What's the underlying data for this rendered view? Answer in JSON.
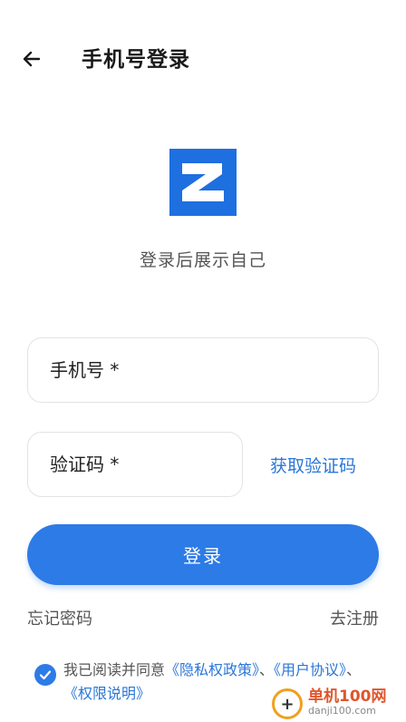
{
  "header": {
    "title": "手机号登录"
  },
  "logo": {
    "letter": "Z",
    "color": "#1e6fe0"
  },
  "tagline": "登录后展示自己",
  "form": {
    "phone_placeholder": "手机号 *",
    "code_placeholder": "验证码 *",
    "get_code_label": "获取验证码",
    "login_label": "登录"
  },
  "links": {
    "forgot": "忘记密码",
    "register": "去注册"
  },
  "agreement": {
    "prefix": "我已阅读并同意",
    "privacy": "《隐私权政策》",
    "sep1": "、",
    "user": "《用户协议》",
    "sep2": "、",
    "permission": "《权限说明》",
    "checked": true
  },
  "watermark": {
    "brand": "单机100网",
    "domain": "danji100.com"
  },
  "colors": {
    "accent": "#2d7be6",
    "link": "#2a76d8"
  }
}
